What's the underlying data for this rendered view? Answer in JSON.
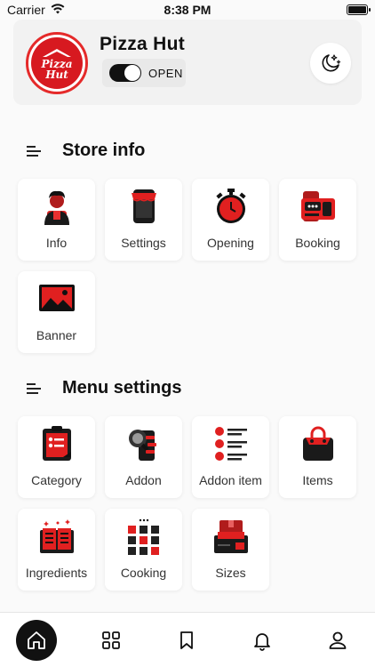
{
  "status_bar": {
    "carrier": "Carrier",
    "time": "8:38 PM"
  },
  "header": {
    "logo_text_line1": "Pizza",
    "logo_text_line2": "Hut",
    "store_name": "Pizza Hut",
    "status_label": "OPEN",
    "is_open": true,
    "theme_toggle_icon": "moon-stars-icon"
  },
  "store_info": {
    "title": "Store info",
    "items": [
      {
        "label": "Info",
        "icon": "person-icon"
      },
      {
        "label": "Settings",
        "icon": "phone-store-icon"
      },
      {
        "label": "Opening",
        "icon": "stopwatch-icon"
      },
      {
        "label": "Booking",
        "icon": "booking-icon"
      },
      {
        "label": "Banner",
        "icon": "image-banner-icon"
      }
    ]
  },
  "menu_settings": {
    "title": "Menu settings",
    "items": [
      {
        "label": "Category",
        "icon": "clipboard-list-icon"
      },
      {
        "label": "Addon",
        "icon": "addon-icon"
      },
      {
        "label": "Addon item",
        "icon": "bullet-list-icon"
      },
      {
        "label": "Items",
        "icon": "shopping-bag-icon"
      },
      {
        "label": "Ingredients",
        "icon": "recipe-book-icon"
      },
      {
        "label": "Cooking",
        "icon": "dots-grid-icon"
      },
      {
        "label": "Sizes",
        "icon": "boxes-icon"
      }
    ]
  },
  "tab_bar": {
    "tabs": [
      {
        "name": "home",
        "icon": "home-icon",
        "active": true
      },
      {
        "name": "grid",
        "icon": "grid-icon",
        "active": false
      },
      {
        "name": "bookmark",
        "icon": "bookmark-icon",
        "active": false
      },
      {
        "name": "notifications",
        "icon": "bell-icon",
        "active": false
      },
      {
        "name": "profile",
        "icon": "user-icon",
        "active": false
      }
    ]
  },
  "colors": {
    "accent": "#e02020",
    "dark": "#111111",
    "background": "#fafafa"
  }
}
